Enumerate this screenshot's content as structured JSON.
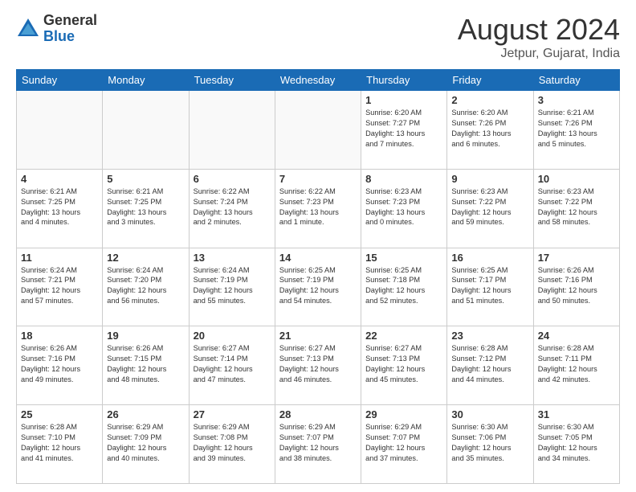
{
  "logo": {
    "general": "General",
    "blue": "Blue"
  },
  "title": {
    "month_year": "August 2024",
    "location": "Jetpur, Gujarat, India"
  },
  "weekdays": [
    "Sunday",
    "Monday",
    "Tuesday",
    "Wednesday",
    "Thursday",
    "Friday",
    "Saturday"
  ],
  "weeks": [
    [
      {
        "day": "",
        "info": ""
      },
      {
        "day": "",
        "info": ""
      },
      {
        "day": "",
        "info": ""
      },
      {
        "day": "",
        "info": ""
      },
      {
        "day": "1",
        "info": "Sunrise: 6:20 AM\nSunset: 7:27 PM\nDaylight: 13 hours\nand 7 minutes."
      },
      {
        "day": "2",
        "info": "Sunrise: 6:20 AM\nSunset: 7:26 PM\nDaylight: 13 hours\nand 6 minutes."
      },
      {
        "day": "3",
        "info": "Sunrise: 6:21 AM\nSunset: 7:26 PM\nDaylight: 13 hours\nand 5 minutes."
      }
    ],
    [
      {
        "day": "4",
        "info": "Sunrise: 6:21 AM\nSunset: 7:25 PM\nDaylight: 13 hours\nand 4 minutes."
      },
      {
        "day": "5",
        "info": "Sunrise: 6:21 AM\nSunset: 7:25 PM\nDaylight: 13 hours\nand 3 minutes."
      },
      {
        "day": "6",
        "info": "Sunrise: 6:22 AM\nSunset: 7:24 PM\nDaylight: 13 hours\nand 2 minutes."
      },
      {
        "day": "7",
        "info": "Sunrise: 6:22 AM\nSunset: 7:23 PM\nDaylight: 13 hours\nand 1 minute."
      },
      {
        "day": "8",
        "info": "Sunrise: 6:23 AM\nSunset: 7:23 PM\nDaylight: 13 hours\nand 0 minutes."
      },
      {
        "day": "9",
        "info": "Sunrise: 6:23 AM\nSunset: 7:22 PM\nDaylight: 12 hours\nand 59 minutes."
      },
      {
        "day": "10",
        "info": "Sunrise: 6:23 AM\nSunset: 7:22 PM\nDaylight: 12 hours\nand 58 minutes."
      }
    ],
    [
      {
        "day": "11",
        "info": "Sunrise: 6:24 AM\nSunset: 7:21 PM\nDaylight: 12 hours\nand 57 minutes."
      },
      {
        "day": "12",
        "info": "Sunrise: 6:24 AM\nSunset: 7:20 PM\nDaylight: 12 hours\nand 56 minutes."
      },
      {
        "day": "13",
        "info": "Sunrise: 6:24 AM\nSunset: 7:19 PM\nDaylight: 12 hours\nand 55 minutes."
      },
      {
        "day": "14",
        "info": "Sunrise: 6:25 AM\nSunset: 7:19 PM\nDaylight: 12 hours\nand 54 minutes."
      },
      {
        "day": "15",
        "info": "Sunrise: 6:25 AM\nSunset: 7:18 PM\nDaylight: 12 hours\nand 52 minutes."
      },
      {
        "day": "16",
        "info": "Sunrise: 6:25 AM\nSunset: 7:17 PM\nDaylight: 12 hours\nand 51 minutes."
      },
      {
        "day": "17",
        "info": "Sunrise: 6:26 AM\nSunset: 7:16 PM\nDaylight: 12 hours\nand 50 minutes."
      }
    ],
    [
      {
        "day": "18",
        "info": "Sunrise: 6:26 AM\nSunset: 7:16 PM\nDaylight: 12 hours\nand 49 minutes."
      },
      {
        "day": "19",
        "info": "Sunrise: 6:26 AM\nSunset: 7:15 PM\nDaylight: 12 hours\nand 48 minutes."
      },
      {
        "day": "20",
        "info": "Sunrise: 6:27 AM\nSunset: 7:14 PM\nDaylight: 12 hours\nand 47 minutes."
      },
      {
        "day": "21",
        "info": "Sunrise: 6:27 AM\nSunset: 7:13 PM\nDaylight: 12 hours\nand 46 minutes."
      },
      {
        "day": "22",
        "info": "Sunrise: 6:27 AM\nSunset: 7:13 PM\nDaylight: 12 hours\nand 45 minutes."
      },
      {
        "day": "23",
        "info": "Sunrise: 6:28 AM\nSunset: 7:12 PM\nDaylight: 12 hours\nand 44 minutes."
      },
      {
        "day": "24",
        "info": "Sunrise: 6:28 AM\nSunset: 7:11 PM\nDaylight: 12 hours\nand 42 minutes."
      }
    ],
    [
      {
        "day": "25",
        "info": "Sunrise: 6:28 AM\nSunset: 7:10 PM\nDaylight: 12 hours\nand 41 minutes."
      },
      {
        "day": "26",
        "info": "Sunrise: 6:29 AM\nSunset: 7:09 PM\nDaylight: 12 hours\nand 40 minutes."
      },
      {
        "day": "27",
        "info": "Sunrise: 6:29 AM\nSunset: 7:08 PM\nDaylight: 12 hours\nand 39 minutes."
      },
      {
        "day": "28",
        "info": "Sunrise: 6:29 AM\nSunset: 7:07 PM\nDaylight: 12 hours\nand 38 minutes."
      },
      {
        "day": "29",
        "info": "Sunrise: 6:29 AM\nSunset: 7:07 PM\nDaylight: 12 hours\nand 37 minutes."
      },
      {
        "day": "30",
        "info": "Sunrise: 6:30 AM\nSunset: 7:06 PM\nDaylight: 12 hours\nand 35 minutes."
      },
      {
        "day": "31",
        "info": "Sunrise: 6:30 AM\nSunset: 7:05 PM\nDaylight: 12 hours\nand 34 minutes."
      }
    ]
  ]
}
